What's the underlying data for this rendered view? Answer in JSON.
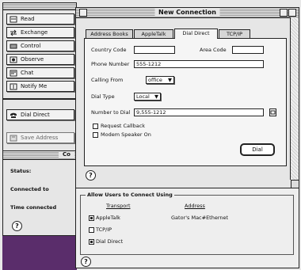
{
  "sidebar": {
    "buttons": [
      {
        "label": "Read",
        "icon": "read-icon"
      },
      {
        "label": "Exchange",
        "icon": "exchange-icon"
      },
      {
        "label": "Control",
        "icon": "control-icon"
      },
      {
        "label": "Observe",
        "icon": "observe-icon"
      },
      {
        "label": "Chat",
        "icon": "chat-icon"
      },
      {
        "label": "Notify Me",
        "icon": "notify-icon"
      }
    ],
    "dial_direct": "Dial Direct",
    "save_address": "Save Address"
  },
  "status_window": {
    "title": "Co",
    "status_label": "Status:",
    "connected_label": "Connected to",
    "time_label": "Time connected"
  },
  "dialog": {
    "title": "New Connection",
    "tabs": [
      "Address Books",
      "AppleTalk",
      "Dial Direct",
      "TCP/IP"
    ],
    "active_tab": "Dial Direct",
    "country_code_label": "Country Code",
    "country_code_value": "",
    "area_code_label": "Area Code",
    "area_code_value": "",
    "phone_label": "Phone Number",
    "phone_value": "555-1212",
    "calling_from_label": "Calling From",
    "calling_from_value": "office",
    "dial_type_label": "Dial Type",
    "dial_type_value": "Local",
    "number_to_dial_label": "Number to Dial",
    "number_to_dial_value": "9,555-1212",
    "request_callback_label": "Request Callback",
    "modem_speaker_label": "Modem Speaker On",
    "dial_button": "Dial"
  },
  "allow": {
    "title": "Allow Users to Connect Using",
    "col_transport": "Transport",
    "col_address": "Address",
    "rows": [
      {
        "transport": "AppleTalk",
        "checked": true,
        "address": "Gator's Mac#Ethernet"
      },
      {
        "transport": "TCP/IP",
        "checked": false,
        "address": ""
      },
      {
        "transport": "Dial Direct",
        "checked": true,
        "address": ""
      }
    ]
  },
  "colors": {
    "desktop_purple": "#5a2d6b",
    "window_gray": "#e6e6e6"
  }
}
